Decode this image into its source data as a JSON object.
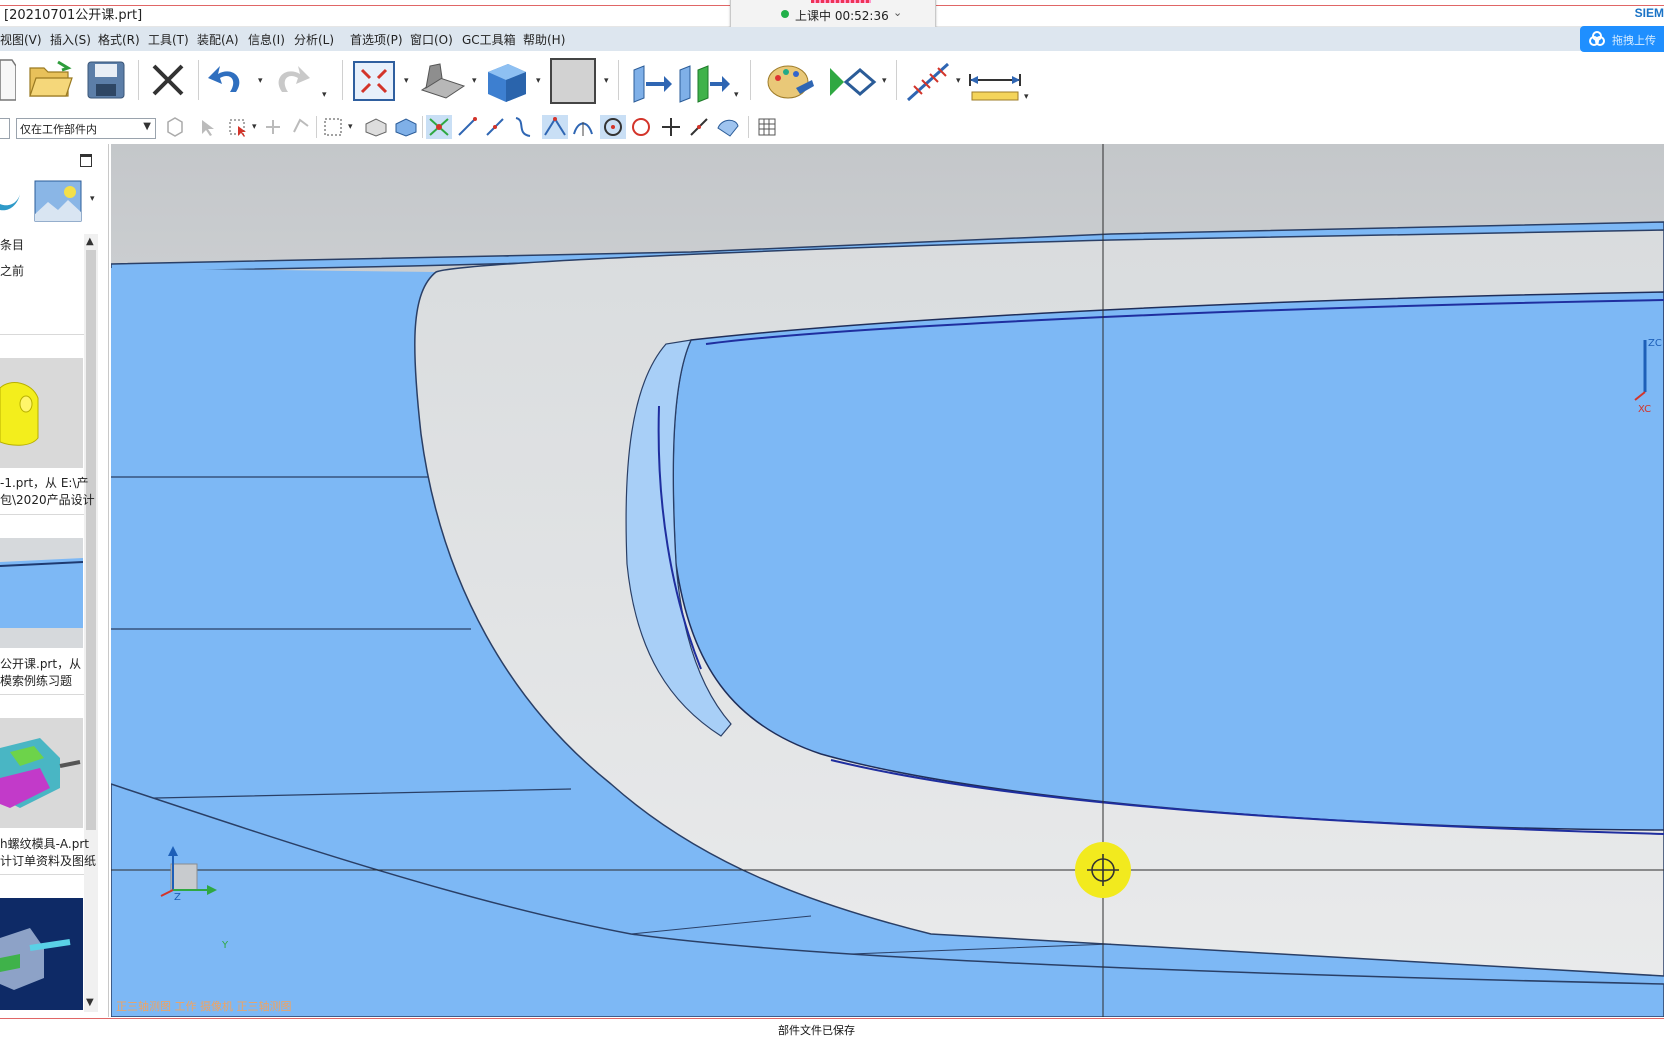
{
  "window": {
    "title": "[20210701公开课.prt]",
    "brand": "SIEM",
    "class_timer": "上课中 00:52:36"
  },
  "menu": {
    "items": [
      "视图(V)",
      "插入(S)",
      "格式(R)",
      "工具(T)",
      "装配(A)",
      "信息(I)",
      "分析(L)",
      "首选项(P)",
      "窗口(O)",
      "GC工具箱",
      "帮助(H)"
    ]
  },
  "cloud_upload": {
    "label": "拖拽上传"
  },
  "toolbar": {
    "filter_value": "仅在工作部件内"
  },
  "left_panel": {
    "history_header": "条目",
    "history_sub": "之前",
    "files": [
      {
        "line1": "-1.prt，从 E:\\产",
        "line2": "包\\2020产品设计"
      },
      {
        "line1": "公开课.prt，从",
        "line2": "模索例练习题"
      },
      {
        "line1": "h螺纹模具-A.prt",
        "line2": "计订单资料及图纸"
      }
    ]
  },
  "viewport": {
    "view_status": "正三轴测图 工作 摄像机 正三轴测图",
    "triad_main": {
      "z": "Z",
      "y": "Y"
    },
    "triad_corner": {
      "z": "ZC",
      "x": "XC"
    }
  },
  "status_bar": {
    "message": "部件文件已保存"
  },
  "colors": {
    "accent": "#1f8fff",
    "menubar": "#dde6ef",
    "surface_blue": "#7db8f5",
    "background": "#c9ccce",
    "cursor_yellow": "#f2ea1e"
  }
}
